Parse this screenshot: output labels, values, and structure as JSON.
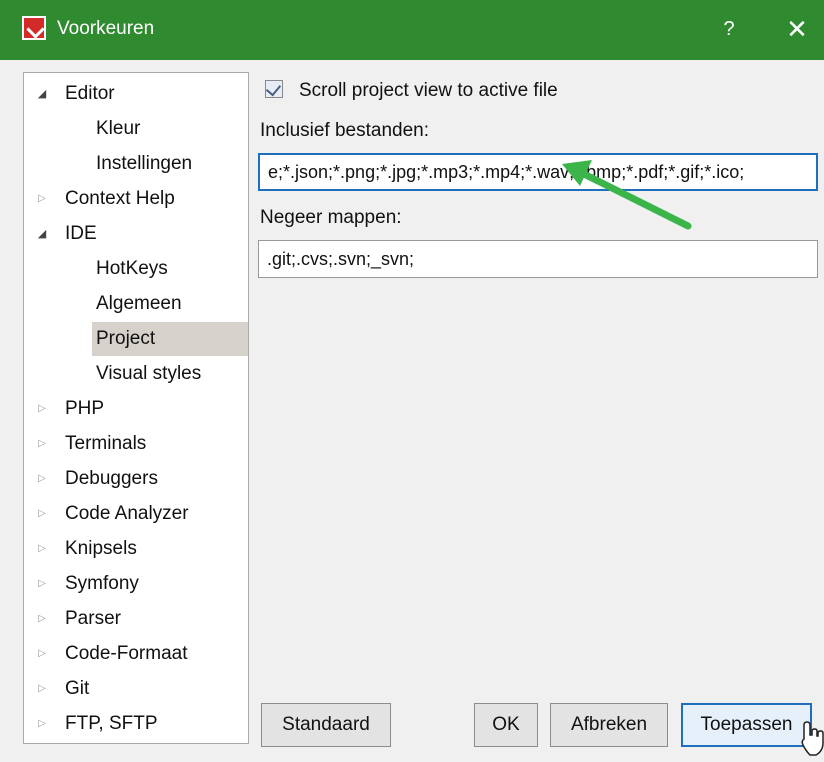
{
  "window": {
    "title": "Voorkeuren",
    "help_label": "?",
    "close_label": "✕"
  },
  "tree": {
    "items": [
      {
        "label": "Editor",
        "expanded": true
      },
      {
        "label": "Kleur"
      },
      {
        "label": "Instellingen"
      },
      {
        "label": "Context Help",
        "expanded": false
      },
      {
        "label": "IDE",
        "expanded": true
      },
      {
        "label": "HotKeys"
      },
      {
        "label": "Algemeen"
      },
      {
        "label": "Project",
        "selected": true
      },
      {
        "label": "Visual styles"
      },
      {
        "label": "PHP",
        "expanded": false
      },
      {
        "label": "Terminals",
        "expanded": false
      },
      {
        "label": "Debuggers",
        "expanded": false
      },
      {
        "label": "Code Analyzer",
        "expanded": false
      },
      {
        "label": "Knipsels",
        "expanded": false
      },
      {
        "label": "Symfony",
        "expanded": false
      },
      {
        "label": "Parser",
        "expanded": false
      },
      {
        "label": "Code-Formaat",
        "expanded": false
      },
      {
        "label": "Git",
        "expanded": false
      },
      {
        "label": "FTP, SFTP",
        "expanded": false
      }
    ]
  },
  "project": {
    "scroll_checkbox_label": "Scroll project view to active file",
    "scroll_checked": true,
    "include_label": "Inclusief bestanden:",
    "include_value": "e;*.json;*.png;*.jpg;*.mp3;*.mp4;*.wav;*.bmp;*.pdf;*.gif;*.ico;",
    "ignore_label": "Negeer mappen:",
    "ignore_value": ".git;.cvs;.svn;_svn;"
  },
  "buttons": {
    "standard": "Standaard",
    "ok": "OK",
    "cancel": "Afbreken",
    "apply": "Toepassen"
  },
  "colors": {
    "titlebar": "#2f8a30",
    "annotation_arrow": "#3bb54a",
    "focus_border": "#1f6fbf"
  }
}
